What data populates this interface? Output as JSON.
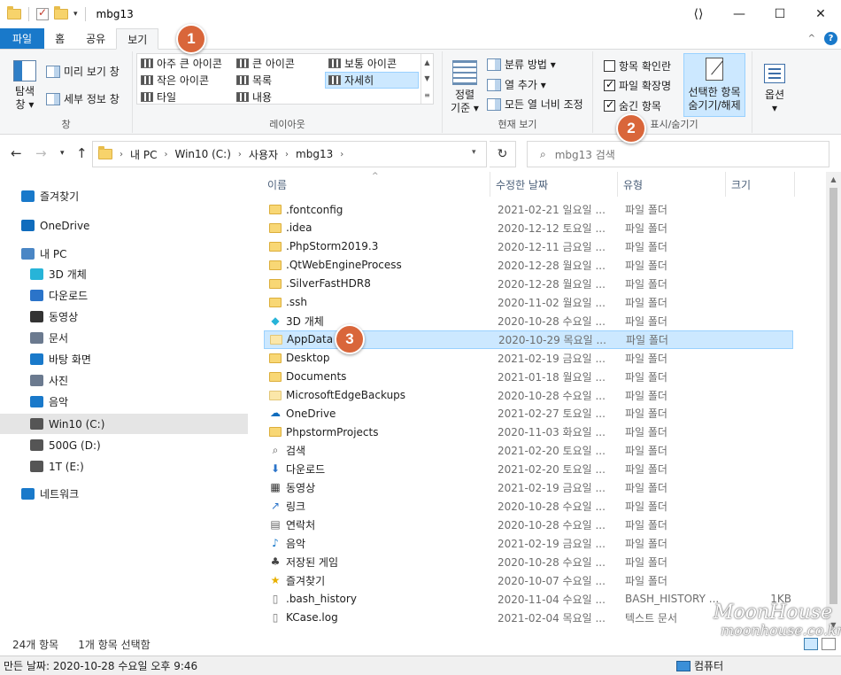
{
  "window": {
    "title": "mbg13",
    "min": "—",
    "max": "☐",
    "close": "✕"
  },
  "ribbon_tabs": {
    "file": "파일",
    "home": "홈",
    "share": "공유",
    "view": "보기"
  },
  "ribbon": {
    "pane_group": {
      "nav_pane_label": "탐색\n창 ▾",
      "preview": "미리 보기 창",
      "details": "세부 정보 창",
      "label": "창"
    },
    "layout_group": {
      "items": [
        "아주 큰 아이콘",
        "큰 아이콘",
        "보통 아이콘",
        "작은 아이콘",
        "목록",
        "자세히",
        "타일",
        "내용"
      ],
      "selected": "자세히",
      "label": "레이아웃"
    },
    "current_view_group": {
      "sort_by": "정렬\n기준 ▾",
      "group_by": "분류 방법 ▾",
      "add_columns": "열 추가 ▾",
      "size_all_columns": "모든 열 너비 조정",
      "label": "현재 보기"
    },
    "show_hide_group": {
      "item_checkboxes": "항목 확인란",
      "item_checkboxes_checked": false,
      "file_extensions": "파일 확장명",
      "file_extensions_checked": true,
      "hidden_items": "숨긴 항목",
      "hidden_items_checked": true,
      "hide_selected": "선택한 항목\n숨기기/해제",
      "label": "표시/숨기기"
    },
    "options": "옵션\n▾"
  },
  "address": {
    "crumbs": [
      "내 PC",
      "Win10 (C:)",
      "사용자",
      "mbg13"
    ],
    "search_placeholder": "mbg13 검색"
  },
  "nav_pane": [
    {
      "label": "즐겨찾기",
      "icon": "star-icon",
      "color": "#1979ca"
    },
    {
      "label": "OneDrive",
      "icon": "cloud-icon",
      "color": "#0f6cbd"
    },
    {
      "label": "내 PC",
      "icon": "pc-icon",
      "color": "#4a86c5"
    },
    {
      "label": "3D 개체",
      "icon": "cube-icon",
      "color": "#27b4d8"
    },
    {
      "label": "다운로드",
      "icon": "download-icon",
      "color": "#2b74c9"
    },
    {
      "label": "동영상",
      "icon": "video-icon",
      "color": "#333333"
    },
    {
      "label": "문서",
      "icon": "document-icon",
      "color": "#6b7a8f"
    },
    {
      "label": "바탕 화면",
      "icon": "desktop-icon",
      "color": "#1979ca"
    },
    {
      "label": "사진",
      "icon": "picture-icon",
      "color": "#6b7a8f"
    },
    {
      "label": "음악",
      "icon": "music-icon",
      "color": "#1979ca"
    },
    {
      "label": "Win10 (C:)",
      "icon": "drive-icon",
      "color": "#555555"
    },
    {
      "label": "500G (D:)",
      "icon": "drive-icon",
      "color": "#555555"
    },
    {
      "label": "1T (E:)",
      "icon": "drive-icon",
      "color": "#555555"
    },
    {
      "label": "네트워크",
      "icon": "network-icon",
      "color": "#1979ca"
    }
  ],
  "columns": {
    "name": "이름",
    "date": "수정한 날짜",
    "type": "유형",
    "size": "크기"
  },
  "files": [
    {
      "name": ".fontconfig",
      "date": "2021-02-21 일요일 ...",
      "type": "파일 폴더",
      "size": "",
      "icon": "folder"
    },
    {
      "name": ".idea",
      "date": "2020-12-12 토요일 ...",
      "type": "파일 폴더",
      "size": "",
      "icon": "folder"
    },
    {
      "name": ".PhpStorm2019.3",
      "date": "2020-12-11 금요일 ...",
      "type": "파일 폴더",
      "size": "",
      "icon": "folder"
    },
    {
      "name": ".QtWebEngineProcess",
      "date": "2020-12-28 월요일 ...",
      "type": "파일 폴더",
      "size": "",
      "icon": "folder"
    },
    {
      "name": ".SilverFastHDR8",
      "date": "2020-12-28 월요일 ...",
      "type": "파일 폴더",
      "size": "",
      "icon": "folder"
    },
    {
      "name": ".ssh",
      "date": "2020-11-02 월요일 ...",
      "type": "파일 폴더",
      "size": "",
      "icon": "folder"
    },
    {
      "name": "3D 개체",
      "date": "2020-10-28 수요일 ...",
      "type": "파일 폴더",
      "size": "",
      "icon": "cube"
    },
    {
      "name": "AppData",
      "date": "2020-10-29 목요일 ...",
      "type": "파일 폴더",
      "size": "",
      "icon": "folder-light"
    },
    {
      "name": "Desktop",
      "date": "2021-02-19 금요일 ...",
      "type": "파일 폴더",
      "size": "",
      "icon": "folder"
    },
    {
      "name": "Documents",
      "date": "2021-01-18 월요일 ...",
      "type": "파일 폴더",
      "size": "",
      "icon": "folder"
    },
    {
      "name": "MicrosoftEdgeBackups",
      "date": "2020-10-28 수요일 ...",
      "type": "파일 폴더",
      "size": "",
      "icon": "folder-light"
    },
    {
      "name": "OneDrive",
      "date": "2021-02-27 토요일 ...",
      "type": "파일 폴더",
      "size": "",
      "icon": "cloud"
    },
    {
      "name": "PhpstormProjects",
      "date": "2020-11-03 화요일 ...",
      "type": "파일 폴더",
      "size": "",
      "icon": "folder"
    },
    {
      "name": "검색",
      "date": "2021-02-20 토요일 ...",
      "type": "파일 폴더",
      "size": "",
      "icon": "search"
    },
    {
      "name": "다운로드",
      "date": "2021-02-20 토요일 ...",
      "type": "파일 폴더",
      "size": "",
      "icon": "download"
    },
    {
      "name": "동영상",
      "date": "2021-02-19 금요일 ...",
      "type": "파일 폴더",
      "size": "",
      "icon": "video"
    },
    {
      "name": "링크",
      "date": "2020-10-28 수요일 ...",
      "type": "파일 폴더",
      "size": "",
      "icon": "link"
    },
    {
      "name": "연락처",
      "date": "2020-10-28 수요일 ...",
      "type": "파일 폴더",
      "size": "",
      "icon": "contacts"
    },
    {
      "name": "음악",
      "date": "2021-02-19 금요일 ...",
      "type": "파일 폴더",
      "size": "",
      "icon": "music"
    },
    {
      "name": "저장된 게임",
      "date": "2020-10-28 수요일 ...",
      "type": "파일 폴더",
      "size": "",
      "icon": "games"
    },
    {
      "name": "즐겨찾기",
      "date": "2020-10-07 수요일 ...",
      "type": "파일 폴더",
      "size": "",
      "icon": "star"
    },
    {
      "name": ".bash_history",
      "date": "2020-11-04 수요일 ...",
      "type": "BASH_HISTORY ...",
      "size": "1KB",
      "icon": "file"
    },
    {
      "name": "KCase.log",
      "date": "2021-02-04 목요일 ...",
      "type": "텍스트 문서",
      "size": "",
      "icon": "file"
    }
  ],
  "selected_file": "AppData",
  "status": {
    "count": "24개 항목",
    "selected": "1개 항목 선택함"
  },
  "detail": {
    "modified": "만든 날짜: 2020-10-28 수요일 오후 9:46",
    "computer": "컴퓨터"
  },
  "badges": [
    "1",
    "2",
    "3"
  ],
  "watermark": {
    "line1": "MoonHouse",
    "line2": "moonhouse.co.kr"
  },
  "colors": {
    "accent": "#1979ca",
    "selection": "#cce8ff",
    "badge": "#d9663a"
  }
}
